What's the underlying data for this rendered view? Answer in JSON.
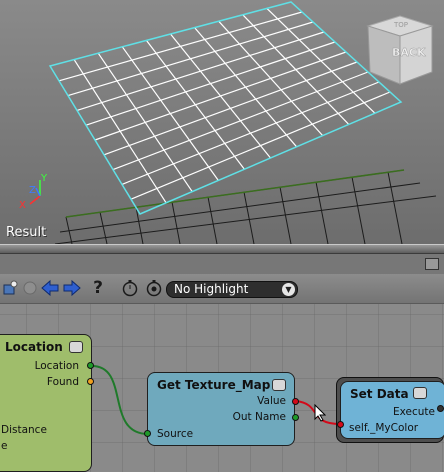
{
  "viewport": {
    "label": "Result",
    "view_cube_face": "BACK",
    "view_cube_top": "TOP"
  },
  "toolbar": {
    "icons": [
      "node-graph-icon",
      "disabled-circle-icon",
      "back-arrow-icon",
      "forward-arrow-icon",
      "help-icon",
      "stopwatch-icon",
      "stopwatch-alt-icon"
    ],
    "help_glyph": "?",
    "highlight": {
      "selected": "No Highlight"
    }
  },
  "nodes": {
    "location": {
      "title": "Location",
      "ports_out": [
        "Location",
        "Found"
      ],
      "ports_in": [
        "Distance",
        "e"
      ],
      "color": "#9fbd6b"
    },
    "get_texture_map": {
      "title": "Get Texture_Map",
      "ports_out": [
        "Value",
        "Out Name"
      ],
      "ports_in": [
        "Source"
      ],
      "color": "#6fa9bd"
    },
    "set_data": {
      "title": "Set Data",
      "ports_out": [
        "Execute"
      ],
      "ports_in": [
        "self._MyColor"
      ],
      "color": "#6fb3d6"
    }
  },
  "colors": {
    "wire_green": "#1f7a2a",
    "wire_red": "#d40a1a",
    "grid_cyan": "#5fe0e6"
  }
}
